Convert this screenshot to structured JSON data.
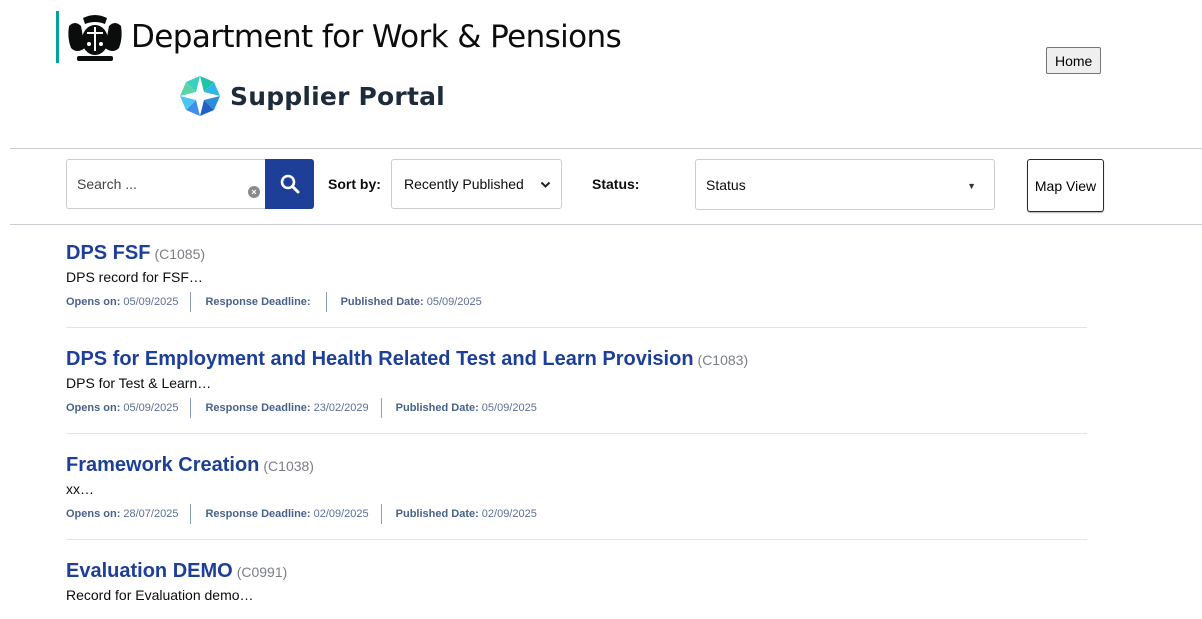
{
  "header": {
    "department": "Department for Work & Pensions",
    "portal_name": "Supplier Portal",
    "home_label": "Home"
  },
  "filters": {
    "search_placeholder": "Search ...",
    "sort_label": "Sort by:",
    "sort_value": "Recently Published",
    "status_label": "Status:",
    "status_value": "Status",
    "map_view_label": "Map View"
  },
  "labels": {
    "opens_on": "Opens on:",
    "response_deadline": "Response Deadline:",
    "published_date": "Published Date:"
  },
  "records": [
    {
      "title": "DPS FSF",
      "code": "(C1085)",
      "description": "DPS record for FSF…",
      "opens_on": "05/09/2025",
      "response_deadline": "",
      "published_date": "05/09/2025"
    },
    {
      "title": "DPS for Employment and Health Related Test and Learn Provision",
      "code": "(C1083)",
      "description": "DPS for Test & Learn…",
      "opens_on": "05/09/2025",
      "response_deadline": "23/02/2029",
      "published_date": "05/09/2025"
    },
    {
      "title": "Framework Creation",
      "code": "(C1038)",
      "description": "xx…",
      "opens_on": "28/07/2025",
      "response_deadline": "02/09/2025",
      "published_date": "02/09/2025"
    },
    {
      "title": "Evaluation DEMO",
      "code": "(C0991)",
      "description": "Record for Evaluation demo…",
      "opens_on": "",
      "response_deadline": "",
      "published_date": ""
    }
  ],
  "colors": {
    "brand_blue": "#1d3f97",
    "teal_bar": "#00a19a",
    "meta_text": "#48628c"
  }
}
